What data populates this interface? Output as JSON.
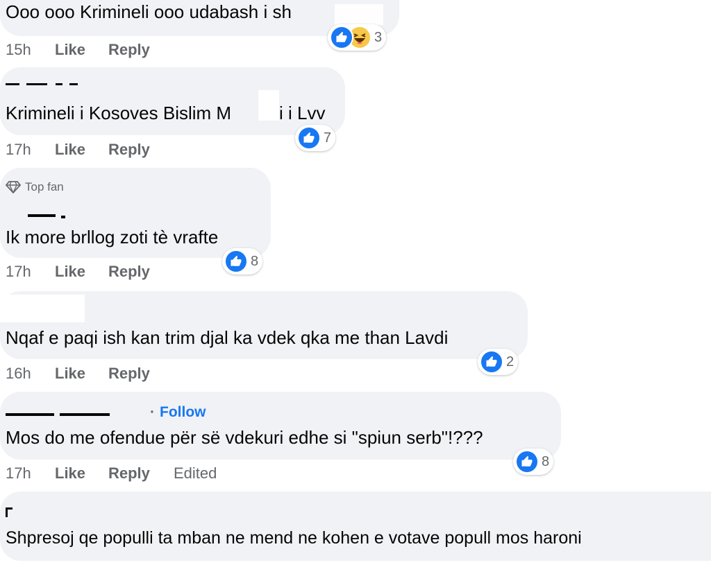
{
  "colors": {
    "bubble_bg": "#f0f2f5",
    "meta_text": "#65676b",
    "like_blue": "#1877f2",
    "follow_blue": "#1877f2",
    "haha_yellow": "#f7c84a"
  },
  "icons": {
    "like": "like-icon",
    "haha": "haha-icon",
    "top_fan": "diamond-icon"
  },
  "labels": {
    "like": "Like",
    "reply": "Reply",
    "edited": "Edited",
    "top_fan": "Top fan",
    "follow": "Follow",
    "dot": "·"
  },
  "comments": [
    {
      "text": "Ooo ooo Krimineli ooo udabash i sh",
      "time": "15h",
      "reaction_count": "3"
    },
    {
      "text": "Krimineli i Kosoves Bislim M",
      "text_tail": "i i Lvv",
      "time": "17h",
      "reaction_count": "7"
    },
    {
      "text": "Ik more brllog zoti tè vrafte",
      "time": "17h",
      "reaction_count": "8"
    },
    {
      "text": "Nqaf e paqi ish kan trim djal ka vdek qka me than Lavdi",
      "time": "16h",
      "reaction_count": "2"
    },
    {
      "text": "Mos do me ofendue për së vdekuri edhe si \"spiun serb\"!???",
      "time": "17h",
      "reaction_count": "8"
    },
    {
      "text": "Shpresoj qe populli ta mban ne mend ne kohen e votave popull mos haroni"
    }
  ]
}
